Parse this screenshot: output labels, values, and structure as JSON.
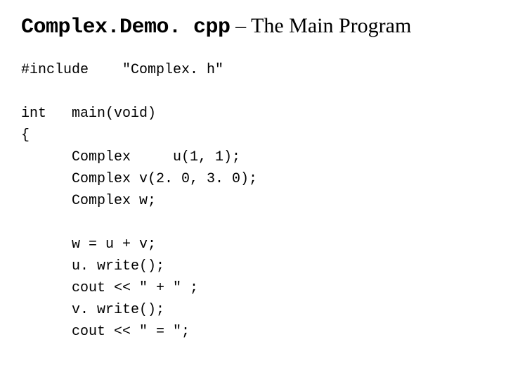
{
  "title": {
    "fileName": "Complex.Demo. cpp",
    "rest": " – The Main Program"
  },
  "code": {
    "l1a": "#include",
    "l1b": "\"Complex. h\"",
    "l2a": "int",
    "l2b": "main(void)",
    "l3": "{",
    "l4": "Complex     u(1, 1);",
    "l5": "Complex v(2. 0, 3. 0);",
    "l6": "Complex w;",
    "l7": "w = u + v;",
    "l8": "u. write();",
    "l9": "cout << \" + \" ;",
    "l10": "v. write();",
    "l11": "cout << \" = \";"
  }
}
